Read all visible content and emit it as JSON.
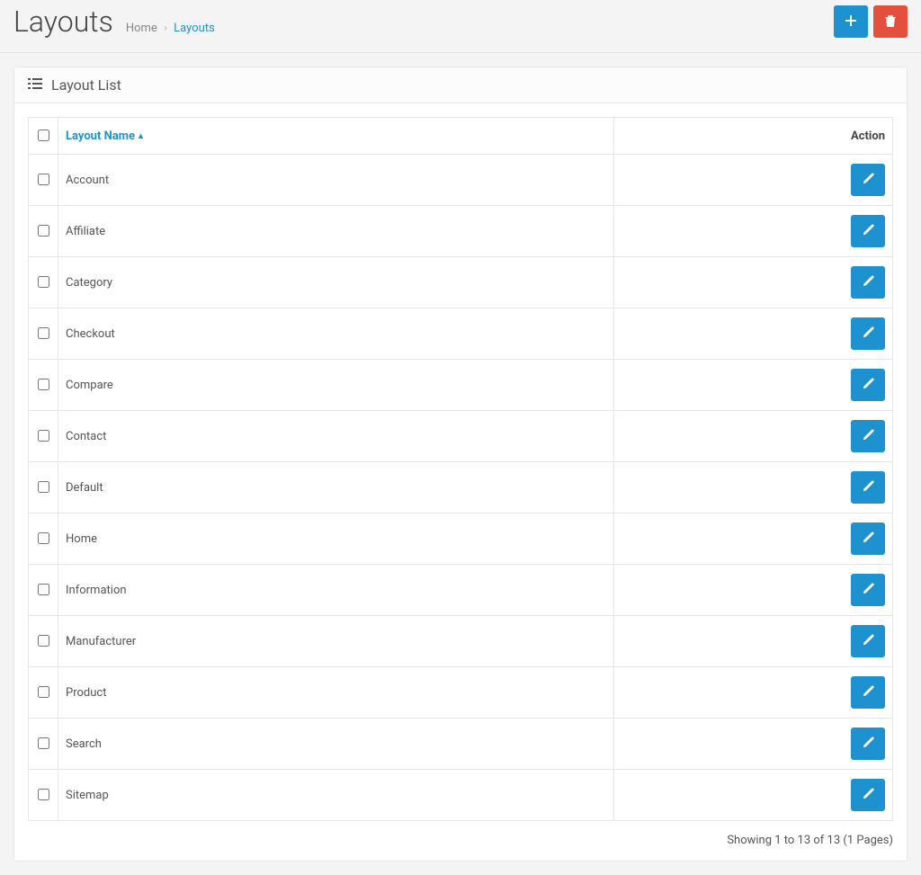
{
  "header": {
    "title": "Layouts",
    "breadcrumb": {
      "home": "Home",
      "current": "Layouts"
    }
  },
  "panel": {
    "title": "Layout List"
  },
  "table": {
    "columns": {
      "name": "Layout Name",
      "action": "Action"
    },
    "rows": [
      {
        "name": "Account"
      },
      {
        "name": "Affiliate"
      },
      {
        "name": "Category"
      },
      {
        "name": "Checkout"
      },
      {
        "name": "Compare"
      },
      {
        "name": "Contact"
      },
      {
        "name": "Default"
      },
      {
        "name": "Home"
      },
      {
        "name": "Information"
      },
      {
        "name": "Manufacturer"
      },
      {
        "name": "Product"
      },
      {
        "name": "Search"
      },
      {
        "name": "Sitemap"
      }
    ]
  },
  "pagination": {
    "text": "Showing 1 to 13 of 13 (1 Pages)"
  }
}
